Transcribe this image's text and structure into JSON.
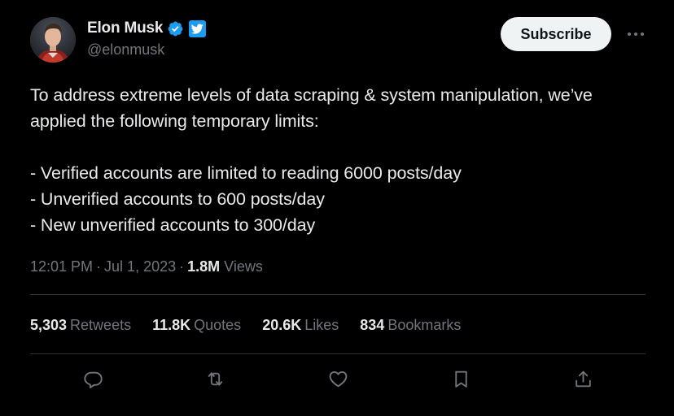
{
  "author": {
    "display_name": "Elon Musk",
    "handle": "@elonmusk",
    "verified_badge": "blue-checkmark-icon",
    "affiliate_badge": "twitter-bird-icon"
  },
  "header": {
    "subscribe_label": "Subscribe",
    "more_icon": "more-horizontal-icon"
  },
  "tweet": {
    "lines": [
      "To address extreme levels of data scraping & system manipulation, we’ve",
      "applied the following temporary limits:",
      "",
      "- Verified accounts are limited to reading 6000 posts/day",
      "- Unverified accounts to 600 posts/day",
      "- New unverified accounts to 300/day"
    ]
  },
  "meta": {
    "time": "12:01 PM",
    "separator": "·",
    "date": "Jul 1, 2023",
    "views_count": "1.8M",
    "views_label": "Views"
  },
  "stats": [
    {
      "count": "5,303",
      "label": "Retweets"
    },
    {
      "count": "11.8K",
      "label": "Quotes"
    },
    {
      "count": "20.6K",
      "label": "Likes"
    },
    {
      "count": "834",
      "label": "Bookmarks"
    }
  ],
  "actions": [
    "reply-icon",
    "retweet-icon",
    "like-icon",
    "bookmark-icon",
    "share-icon"
  ],
  "colors": {
    "background": "#000000",
    "text_primary": "#e7e9ea",
    "text_secondary": "#71767b",
    "divider": "#2f3336",
    "accent": "#1d9bf0",
    "button_bg": "#eff3f4"
  }
}
